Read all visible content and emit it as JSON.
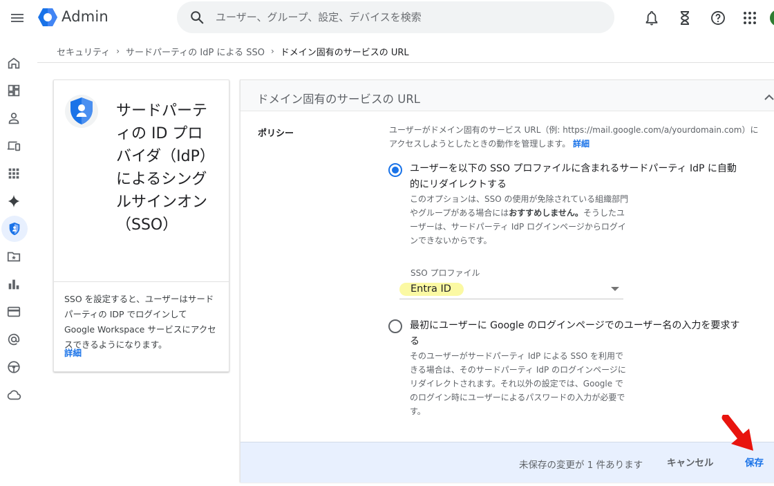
{
  "topbar": {
    "app_title": "Admin",
    "search_placeholder": "ユーザー、グループ、設定、デバイスを検索"
  },
  "breadcrumb": {
    "items": [
      "セキュリティ",
      "サードパーティの IdP による SSO",
      "ドメイン固有のサービスの URL"
    ],
    "separator": "›"
  },
  "info_card": {
    "title": "サードパーティの ID プロバイダ（IdP）によるシングルサインオン（SSO）",
    "description": "SSO を設定すると、ユーザーはサードパーティの IDP でログインして Google Workspace サービスにアクセスできるようになります。",
    "link": "詳細"
  },
  "panel": {
    "title": "ドメイン固有のサービスの URL",
    "policy_label": "ポリシー",
    "policy_description": "ユーザーがドメイン固有のサービス URL（例: https://mail.google.com/a/yourdomain.com）にアクセスしようとしたときの動作を管理します。",
    "policy_link": "詳細",
    "option1": {
      "label": "ユーザーを以下の SSO プロファイルに含まれるサードパーティ IdP に自動的にリダイレクトする",
      "help_before": "このオプションは、SSO の使用が免除されている組織部門やグループがある場合には",
      "help_bold": "おすすめしません。",
      "help_after": "そうしたユーザーは、サードパーティ IdP ログインページからログインできないからです。",
      "selected": true
    },
    "sso_profile": {
      "label": "SSO プロファイル",
      "value": "Entra ID"
    },
    "option2": {
      "label": "最初にユーザーに Google のログインページでのユーザー名の入力を要求する",
      "help": "そのユーザーがサードパーティ IdP による SSO を利用できる場合は、そのサードパーティ IdP のログインページにリダイレクトされます。それ以外の設定では、Google でのログイン時にユーザーによるパスワードの入力が必要です。",
      "selected": false
    },
    "footer": {
      "unsaved_text": "未保存の変更が 1 件あります",
      "cancel_label": "キャンセル",
      "save_label": "保存"
    }
  },
  "colors": {
    "accent": "#1a73e8",
    "footer_bg": "#e8f0fe",
    "highlight": "#fbf9a3",
    "annotation_arrow": "#e8140e"
  },
  "icons": {
    "topbar": [
      "menu-icon",
      "notifications-icon",
      "hourglass-icon",
      "help-icon",
      "apps-grid-icon"
    ],
    "rail": [
      "home-icon",
      "dashboard-icon",
      "user-icon",
      "devices-icon",
      "apps-icon",
      "sparkle-icon",
      "security-shield-icon",
      "folder-star-icon",
      "reports-icon",
      "billing-icon",
      "account-at-icon",
      "rules-icon",
      "cloud-icon"
    ]
  }
}
